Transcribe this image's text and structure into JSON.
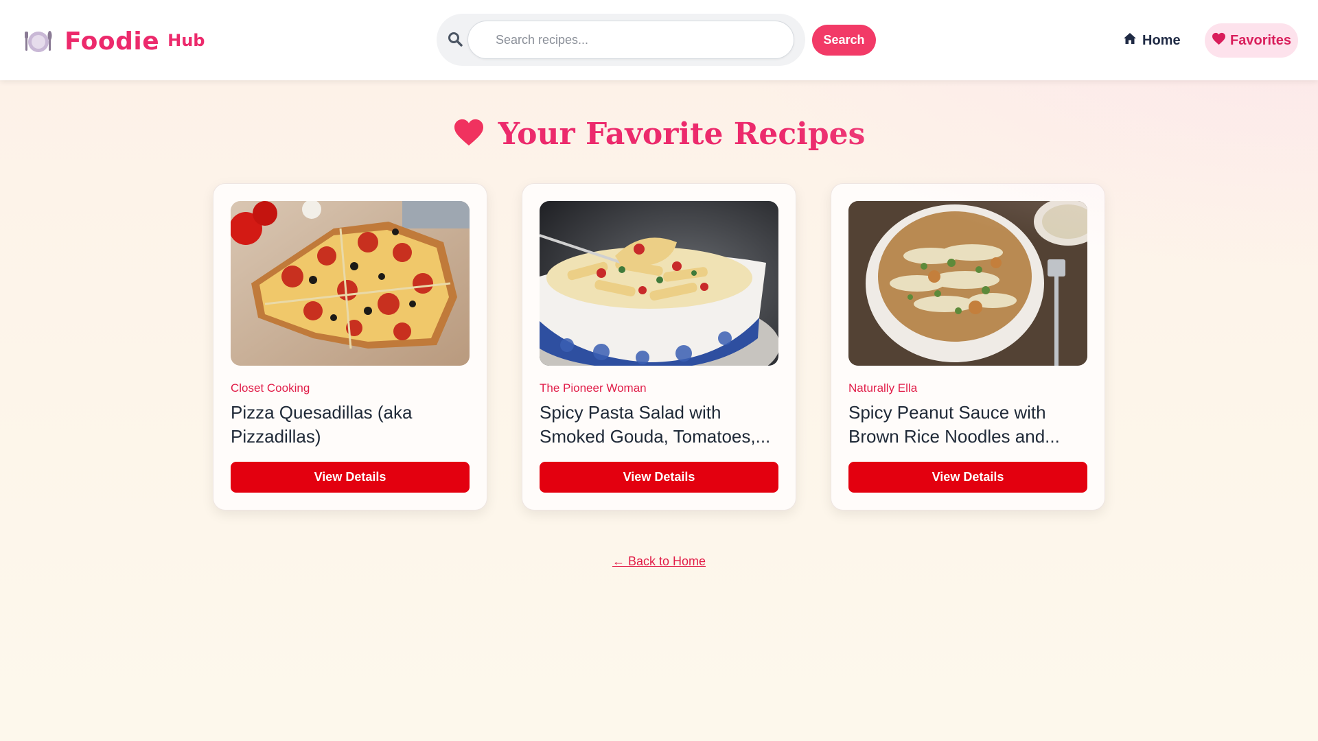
{
  "header": {
    "logo_word": "Foodie",
    "logo_sub": "Hub",
    "search": {
      "placeholder": "Search recipes...",
      "value": "",
      "button_label": "Search"
    },
    "nav": {
      "home_label": "Home",
      "favorites_label": "Favorites"
    }
  },
  "page": {
    "title": "Your Favorite Recipes",
    "back_link": "← Back to Home"
  },
  "recipes": [
    {
      "source": "Closet Cooking",
      "title": "Pizza Quesadillas (aka Pizzadillas)",
      "button_label": "View Details"
    },
    {
      "source": "The Pioneer Woman",
      "title": "Spicy Pasta Salad with Smoked Gouda, Tomatoes,...",
      "button_label": "View Details"
    },
    {
      "source": "Naturally Ella",
      "title": "Spicy Peanut Sauce with Brown Rice Noodles and...",
      "button_label": "View Details"
    }
  ],
  "colors": {
    "brand_pink": "#ec2a6c",
    "search_button": "#f23a67",
    "view_button": "#e3000f",
    "source_text": "#e11d48"
  }
}
